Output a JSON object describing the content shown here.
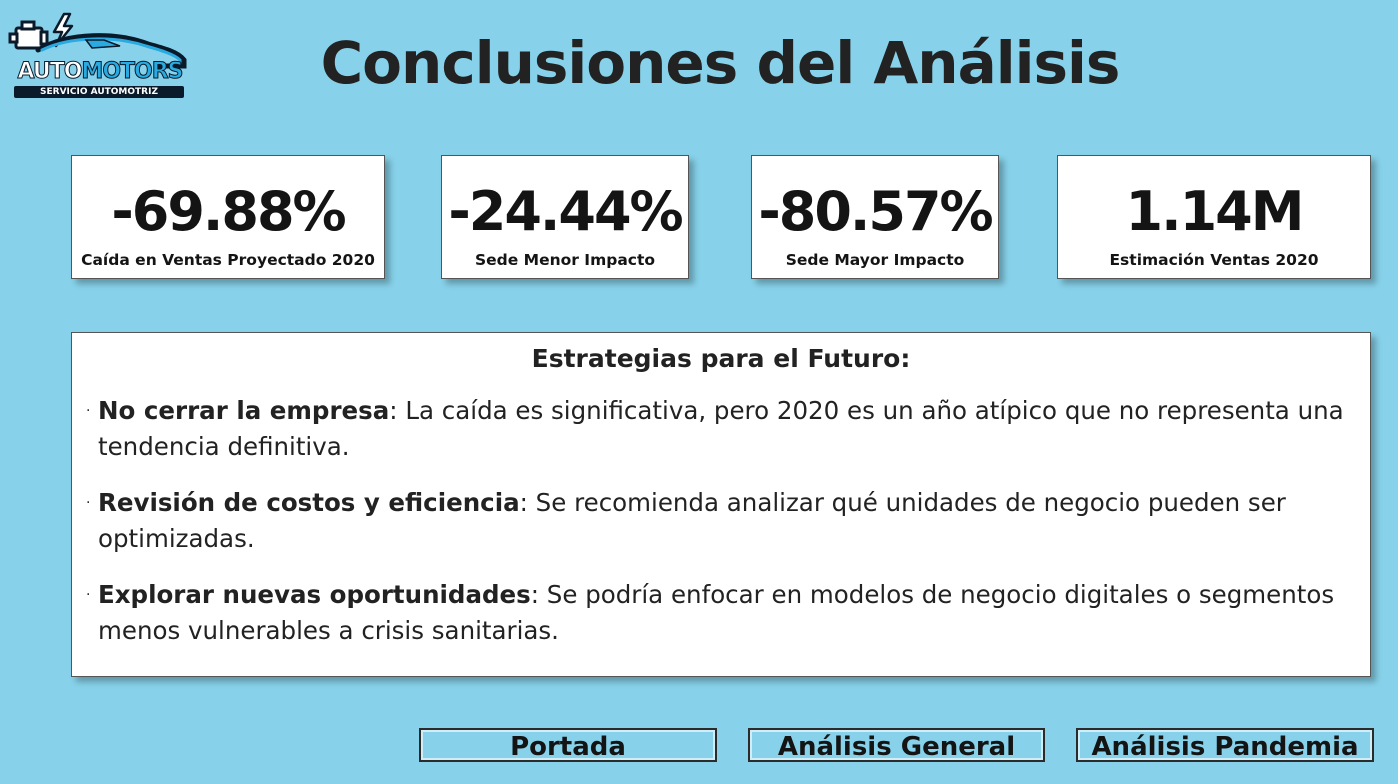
{
  "logo": {
    "brand_part1": "AUTO",
    "brand_part2": "MOTORS",
    "tagline": "SERVICIO AUTOMOTRIZ"
  },
  "header": {
    "title": "Conclusiones del Análisis"
  },
  "kpis": [
    {
      "value": "-69.88%",
      "label": "Caída en Ventas Proyectado 2020"
    },
    {
      "value": "-24.44%",
      "label": "Sede Menor Impacto"
    },
    {
      "value": "-80.57%",
      "label": "Sede Mayor Impacto"
    },
    {
      "value": "1.14M",
      "label": "Estimación Ventas 2020"
    }
  ],
  "strategies": {
    "heading": "Estrategias para el Futuro:",
    "items": [
      {
        "title": "No cerrar la empresa",
        "text": ": La caída es significativa, pero 2020 es un año atípico que no representa una tendencia definitiva."
      },
      {
        "title": "Revisión de costos y eficiencia",
        "text": ": Se recomienda analizar qué unidades de negocio pueden ser optimizadas."
      },
      {
        "title": "Explorar nuevas oportunidades",
        "text": ": Se podría enfocar en modelos de negocio digitales o segmentos menos vulnerables a crisis sanitarias."
      }
    ]
  },
  "nav": {
    "portada": "Portada",
    "general": "Análisis General",
    "pandemia": "Análisis Pandemia"
  },
  "colors": {
    "background": "#87d2ea",
    "card": "#ffffff",
    "brand_blue": "#29aae1",
    "text": "#222222"
  },
  "icons": [
    "car-logo-icon",
    "engine-icon",
    "lightning-icon"
  ]
}
